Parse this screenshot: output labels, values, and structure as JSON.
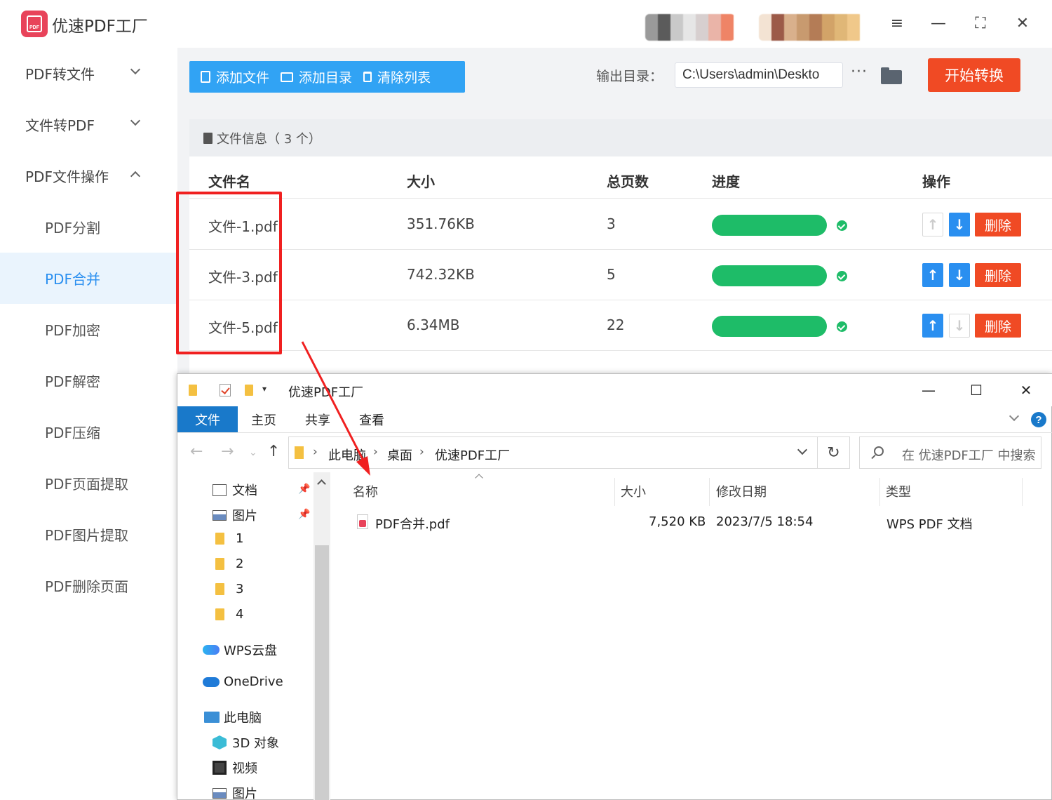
{
  "app": {
    "title": "优速PDF工厂",
    "logo_text": "PDF"
  },
  "window_controls": {
    "menu_icon": "hamburger-icon",
    "minimize_icon": "minimize-icon",
    "maximize_icon": "fullscreen-icon",
    "close_icon": "close-icon"
  },
  "sidebar": {
    "groups": [
      {
        "label": "PDF转文件",
        "expanded": false
      },
      {
        "label": "文件转PDF",
        "expanded": false
      },
      {
        "label": "PDF文件操作",
        "expanded": true
      }
    ],
    "items": [
      {
        "label": "PDF分割",
        "active": false
      },
      {
        "label": "PDF合并",
        "active": true
      },
      {
        "label": "PDF加密",
        "active": false
      },
      {
        "label": "PDF解密",
        "active": false
      },
      {
        "label": "PDF压缩",
        "active": false
      },
      {
        "label": "PDF页面提取",
        "active": false
      },
      {
        "label": "PDF图片提取",
        "active": false
      },
      {
        "label": "PDF删除页面",
        "active": false
      }
    ]
  },
  "toolbar": {
    "add_file": "添加文件",
    "add_dir": "添加目录",
    "clear_list": "清除列表",
    "output_label": "输出目录：",
    "output_path": "C:\\Users\\admin\\Deskto",
    "more": "···",
    "start": "开始转换"
  },
  "file_panel": {
    "header": "文件信息（ 3 个）",
    "columns": [
      "文件名",
      "大小",
      "总页数",
      "进度",
      "操作"
    ],
    "rows": [
      {
        "name": "文件-1.pdf",
        "size": "351.76KB",
        "pages": "3",
        "progress": 1.0,
        "up_enabled": false,
        "down_enabled": true,
        "delete": "删除"
      },
      {
        "name": "文件-3.pdf",
        "size": "742.32KB",
        "pages": "5",
        "progress": 1.0,
        "up_enabled": true,
        "down_enabled": true,
        "delete": "删除"
      },
      {
        "name": "文件-5.pdf",
        "size": "6.34MB",
        "pages": "22",
        "progress": 1.0,
        "up_enabled": true,
        "down_enabled": false,
        "delete": "删除"
      }
    ]
  },
  "explorer": {
    "title": "优速PDF工厂",
    "tabs": [
      "文件",
      "主页",
      "共享",
      "查看"
    ],
    "active_tab": "文件",
    "breadcrumb": [
      "此电脑",
      "桌面",
      "优速PDF工厂"
    ],
    "search_placeholder": "在 优速PDF工厂 中搜索",
    "tree": {
      "quick": [
        {
          "label": "文档",
          "icon": "document-icon",
          "pinned": true
        },
        {
          "label": "图片",
          "icon": "pictures-icon",
          "pinned": true
        },
        {
          "label": "1",
          "icon": "folder-icon"
        },
        {
          "label": "2",
          "icon": "folder-icon"
        },
        {
          "label": "3",
          "icon": "folder-icon"
        },
        {
          "label": "4",
          "icon": "folder-icon"
        }
      ],
      "wps_cloud": "WPS云盘",
      "onedrive": "OneDrive",
      "this_pc": "此电脑",
      "pc_items": [
        {
          "label": "3D 对象",
          "icon": "3d-objects-icon"
        },
        {
          "label": "视频",
          "icon": "video-icon"
        },
        {
          "label": "图片",
          "icon": "pictures-icon"
        }
      ]
    },
    "columns": [
      "名称",
      "大小",
      "修改日期",
      "类型"
    ],
    "files": [
      {
        "name": "PDF合并.pdf",
        "size": "7,520 KB",
        "modified": "2023/7/5 18:54",
        "type": "WPS PDF 文档"
      }
    ]
  },
  "colors": {
    "primary_blue": "#31a3f4",
    "accent_red": "#f04a24",
    "progress_green": "#1ebc68",
    "annotation_red": "#f02020"
  }
}
